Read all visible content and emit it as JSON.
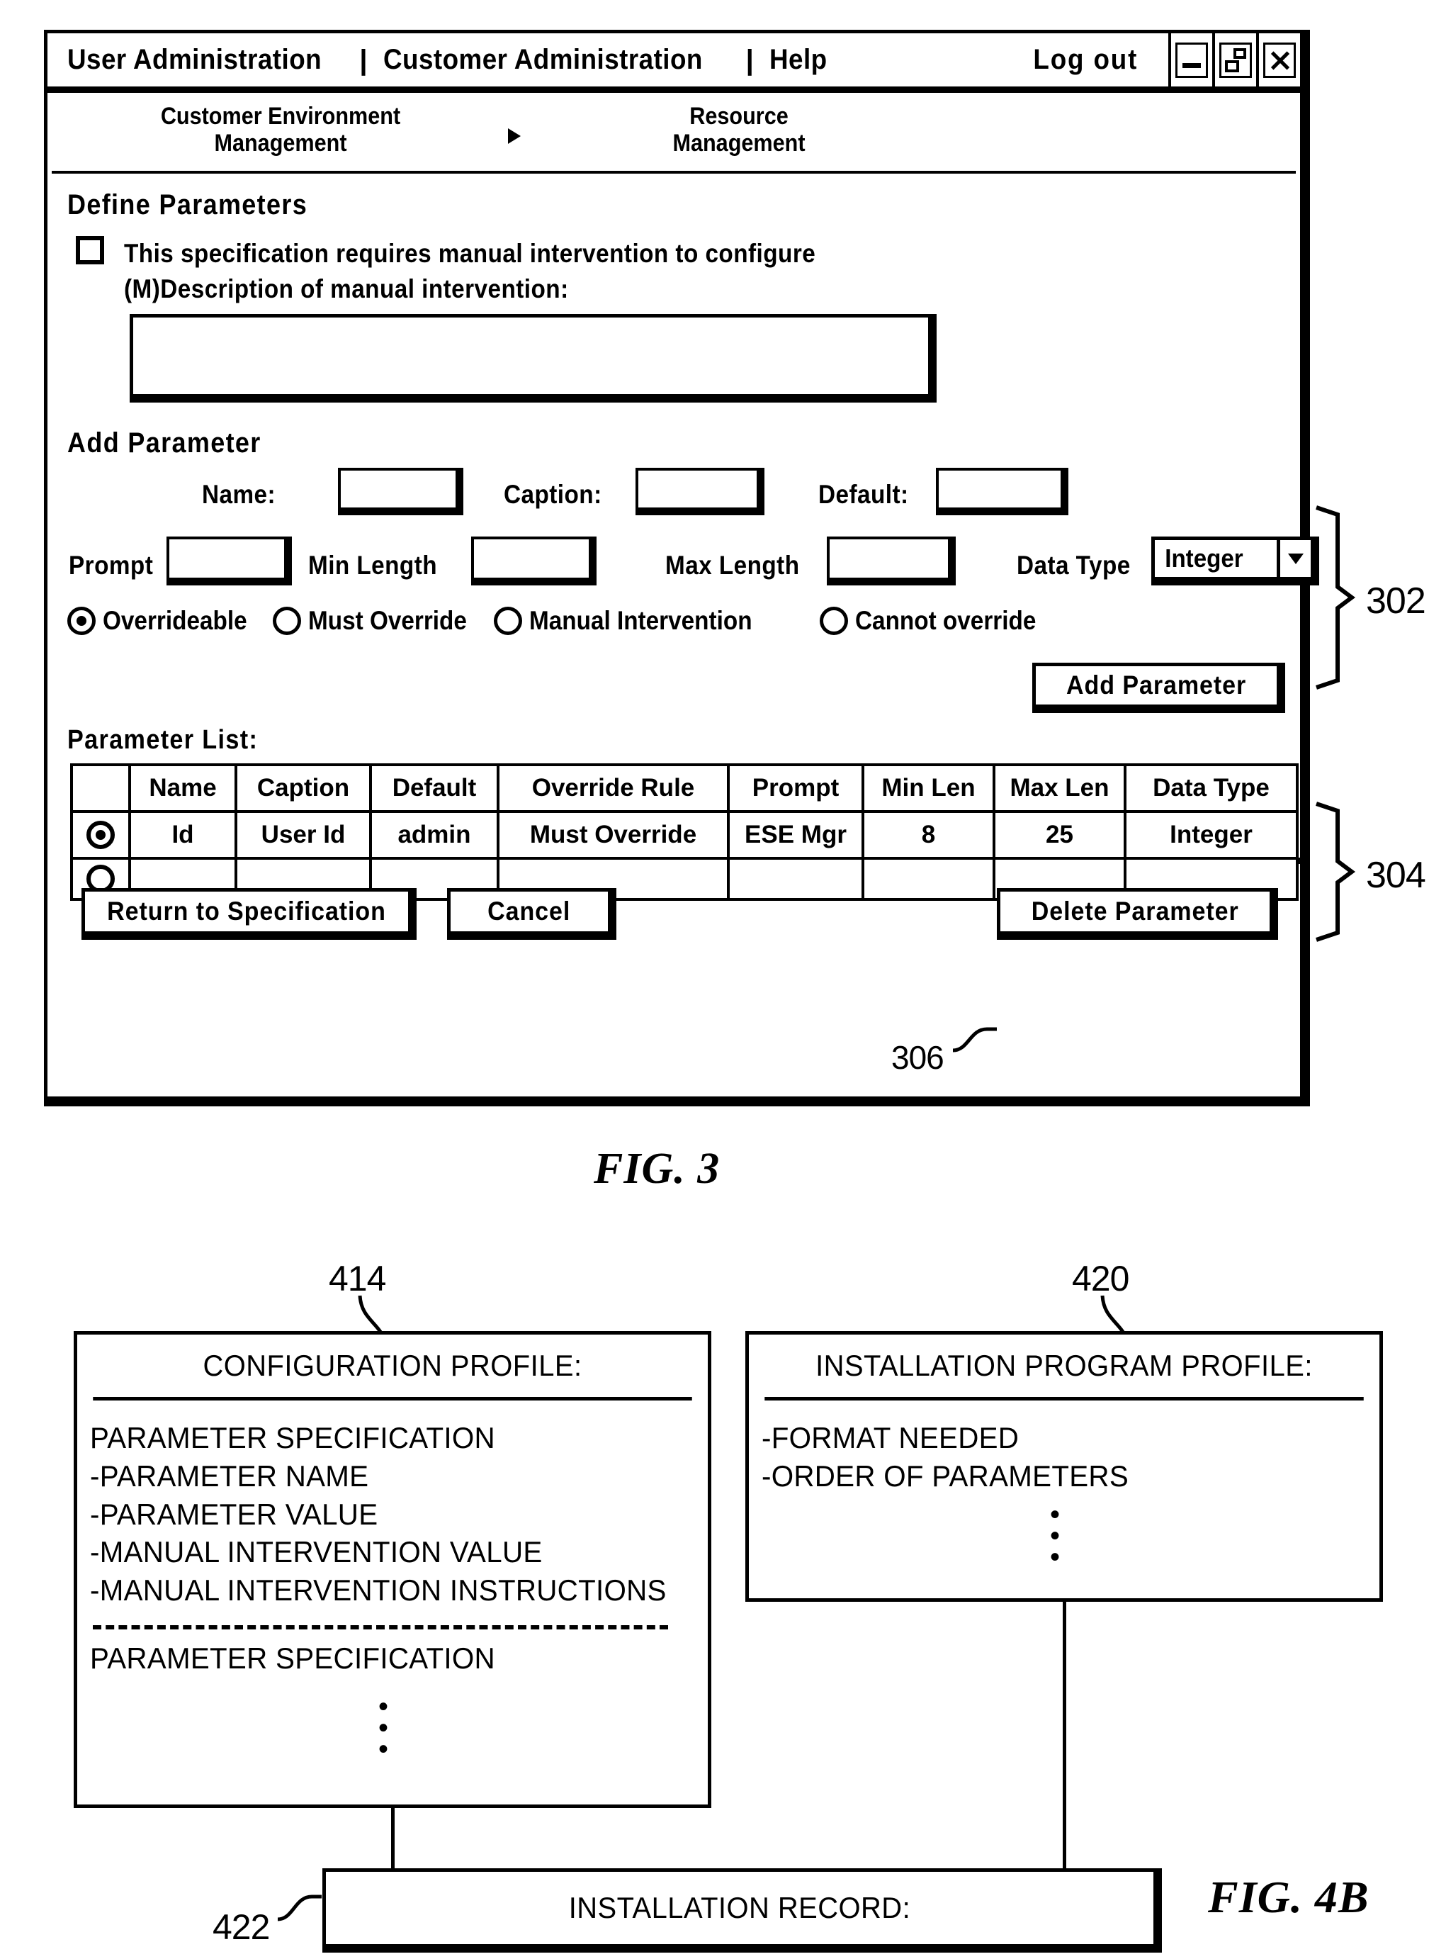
{
  "fig3": {
    "label": "FIG. 3",
    "titlebar": {
      "menu_items": [
        "User Administration",
        "Customer Administration",
        "Help"
      ],
      "separator": "|",
      "logout_label": "Log out",
      "window_controls": [
        "minimize-icon",
        "restore-icon",
        "close-icon"
      ]
    },
    "breadcrumb": {
      "first": "Customer Environment\nManagement",
      "arrow": "triangle-right-icon",
      "second": "Resource\nManagement"
    },
    "define_parameters": {
      "heading": "Define Parameters",
      "checkbox_label": "This specification requires manual intervention to configure",
      "checkbox_checked": false,
      "description_label": "(M)Description of manual intervention:",
      "description_value": ""
    },
    "add_parameter": {
      "heading": "Add Parameter",
      "fields": [
        {
          "label": "Name:",
          "value": ""
        },
        {
          "label": "Caption:",
          "value": ""
        },
        {
          "label": "Default:",
          "value": ""
        },
        {
          "label": "Prompt",
          "value": ""
        },
        {
          "label": "Min Length",
          "value": ""
        },
        {
          "label": "Max Length",
          "value": ""
        }
      ],
      "data_type": {
        "label": "Data Type",
        "value": "Integer"
      },
      "override_options": [
        {
          "label": "Overrideable",
          "selected": true
        },
        {
          "label": "Must Override",
          "selected": false
        },
        {
          "label": "Manual Intervention",
          "selected": false
        },
        {
          "label": "Cannot override",
          "selected": false
        }
      ],
      "add_button": "Add Parameter"
    },
    "parameter_list": {
      "heading": "Parameter List:",
      "columns": [
        "Name",
        "Caption",
        "Default",
        "Override Rule",
        "Prompt",
        "Min Len",
        "Max Len",
        "Data Type"
      ],
      "rows": [
        {
          "selected": true,
          "cells": [
            "Id",
            "User Id",
            "admin",
            "Must Override",
            "ESE Mgr",
            "8",
            "25",
            "Integer"
          ]
        },
        {
          "selected": false,
          "cells": [
            "",
            "",
            "",
            "",
            "",
            "",
            "",
            ""
          ]
        }
      ]
    },
    "footer_buttons": {
      "return": "Return to Specification",
      "cancel": "Cancel",
      "delete": "Delete Parameter"
    },
    "reference_numerals": {
      "add_parameter_group": "302",
      "parameter_list_group": "304",
      "delete_button": "306"
    }
  },
  "fig4b": {
    "label": "FIG. 4B",
    "config_profile": {
      "ref": "414",
      "title": "CONFIGURATION PROFILE:",
      "lines": [
        "PARAMETER SPECIFICATION",
        " -PARAMETER NAME",
        " -PARAMETER VALUE",
        " -MANUAL INTERVENTION VALUE",
        " -MANUAL INTERVENTION INSTRUCTIONS"
      ],
      "divider": "dashed-divider",
      "second_spec": "PARAMETER SPECIFICATION",
      "ellipsis": "vertical-ellipsis"
    },
    "install_program_profile": {
      "ref": "420",
      "title": "INSTALLATION PROGRAM PROFILE:",
      "lines": [
        "-FORMAT NEEDED",
        "-ORDER OF PARAMETERS"
      ],
      "ellipsis": "vertical-ellipsis"
    },
    "installation_record": {
      "ref": "422",
      "title": "INSTALLATION RECORD:"
    }
  }
}
